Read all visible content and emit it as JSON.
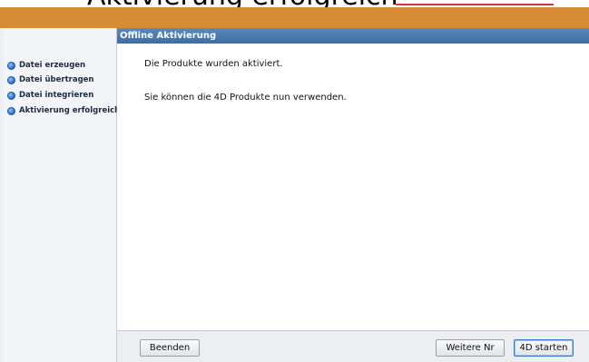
{
  "header": {
    "top_clipped_text": "Aktivierung erfolgreich",
    "panel_title": "Offline Aktivierung"
  },
  "sidebar": {
    "items": [
      {
        "label": "Datei erzeugen"
      },
      {
        "label": "Datei übertragen"
      },
      {
        "label": "Datei integrieren"
      },
      {
        "label": "Aktivierung erfolgreich"
      }
    ]
  },
  "main": {
    "message_1": "Die Produkte wurden aktiviert.",
    "message_2": "Sie können die 4D Produkte nun verwenden."
  },
  "footer": {
    "quit_label": "Beenden",
    "next_label": "Weitere Nr",
    "start_label": "4D starten"
  },
  "colors": {
    "accent_bar": "#d68b37",
    "panel_header": "#4a7ab0",
    "bullet": "#2d78d8"
  }
}
